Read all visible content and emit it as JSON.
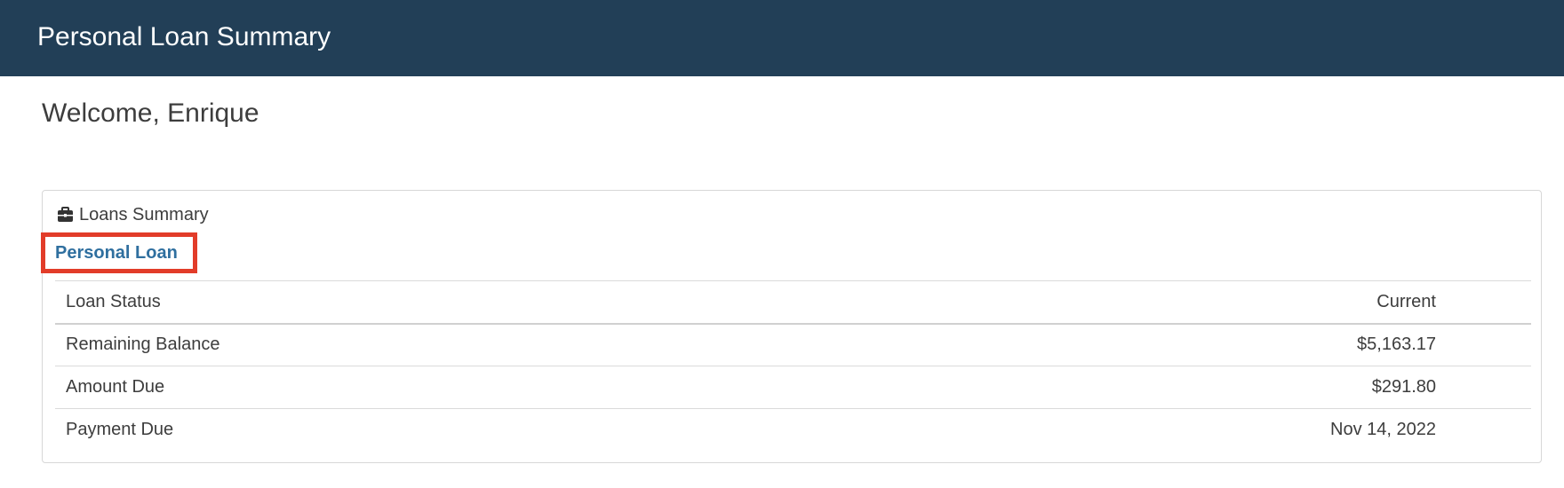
{
  "header": {
    "title": "Personal Loan Summary"
  },
  "welcome": {
    "text": "Welcome, Enrique"
  },
  "loans_summary": {
    "heading": "Loans Summary",
    "icon": "briefcase-icon",
    "loan_link": "Personal Loan",
    "highlight_color": "#e23c29",
    "rows": [
      {
        "label": "Loan Status",
        "value": "Current"
      },
      {
        "label": "Remaining Balance",
        "value": "$5,163.17"
      },
      {
        "label": "Amount Due",
        "value": "$291.80"
      },
      {
        "label": "Payment Due",
        "value": "Nov 14, 2022"
      }
    ]
  },
  "colors": {
    "header_bg": "#223f57",
    "link": "#2f6f9f"
  }
}
